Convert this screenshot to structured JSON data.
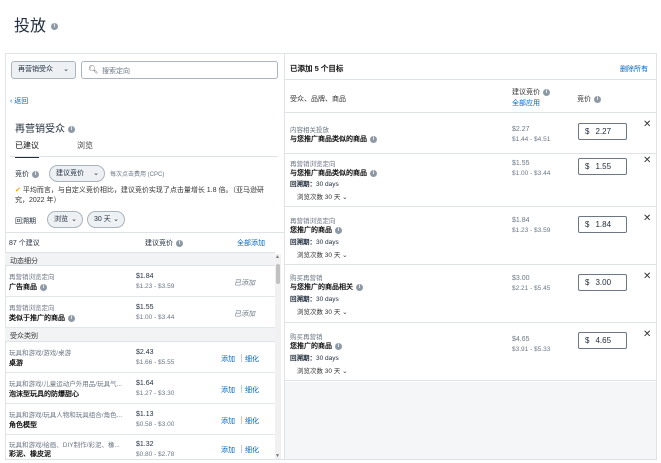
{
  "page": {
    "title": "投放"
  },
  "left": {
    "audience_dropdown": "再营销受众",
    "search_placeholder": "搜索定向",
    "back_label": "返回",
    "section_title": "再营销受众",
    "tabs": [
      "已建议",
      "浏览"
    ],
    "bid_label": "竞价",
    "bid_select": "建议竞价",
    "bid_note": "每次点击费用 (CPC)",
    "tip": "平均而言，与自定义竞价相比，建议竞价实现了点击量增长 1.8 倍。（亚马逊研究，2022 年）",
    "lookback_label": "回溯期",
    "lookback_select1": "浏览",
    "lookback_select2": "30 天",
    "count_label": "87 个建议",
    "suggested_bid_header": "建议竞价",
    "add_all": "全部添加",
    "groups": [
      {
        "name": "动态细分",
        "items": [
          {
            "category": "再营销浏览定向",
            "title": "广告商品",
            "bid": "$1.84",
            "range": "$1.23 - $3.59",
            "status": "已添加"
          },
          {
            "category": "再营销浏览定向",
            "title": "类似于推广的商品",
            "bid": "$1.55",
            "range": "$1.00 - $3.44",
            "status": "已添加"
          }
        ]
      },
      {
        "name": "受众类别",
        "items": [
          {
            "category": "玩具和游戏/游戏/桌游",
            "title": "桌游",
            "bid": "$2.43",
            "range": "$1.66 - $5.55",
            "add": "添加",
            "refine": "细化"
          },
          {
            "category": "玩具和游戏/儿童运动户外用品/玩具气...",
            "title": "泡沫型玩具的防爆甜心",
            "bid": "$1.64",
            "range": "$1.27 - $3.30",
            "add": "添加",
            "refine": "细化"
          },
          {
            "category": "玩具和游戏/玩具人物和玩具组合/角色...",
            "title": "角色模型",
            "bid": "$1.13",
            "range": "$0.58 - $3.00",
            "add": "添加",
            "refine": "细化"
          },
          {
            "category": "玩具和游戏/绘画、DIY制作/彩泥、橡...",
            "title": "彩泥、橡皮泥",
            "bid": "$1.32",
            "range": "$0.80 - $2.78",
            "add": "添加",
            "refine": "细化"
          }
        ]
      }
    ]
  },
  "right": {
    "header": "已添加 5 个目标",
    "remove_all": "删除所有",
    "col_audience": "受众、品牌、商品",
    "col_suggested": "建议竞价",
    "apply_all": "全部应用",
    "col_bid": "竞价",
    "lookback_prefix": "回溯期：",
    "items": [
      {
        "category": "内容相关投放",
        "title": "与您推广商品类似的商品",
        "lookback": "",
        "browse": "",
        "bid": "$2.27",
        "range": "$1.44 - $4.51",
        "value": "2.27"
      },
      {
        "category": "再营销浏览定向",
        "title": "与您推广商品类似的商品",
        "lookback": "30 days",
        "browse": "浏览次数 30 天",
        "bid": "$1.55",
        "range": "$1.00 - $3.44",
        "value": "1.55"
      },
      {
        "category": "再营销浏览定向",
        "title": "您推广的商品",
        "lookback": "30 days",
        "browse": "浏览次数 30 天",
        "bid": "$1.84",
        "range": "$1.23 - $3.59",
        "value": "1.84"
      },
      {
        "category": "购买再营销",
        "title": "与您推广的商品相关",
        "lookback": "30 days",
        "browse": "浏览次数 30 天",
        "bid": "$3.00",
        "range": "$2.21 - $5.45",
        "value": "3.00"
      },
      {
        "category": "购买再营销",
        "title": "您推广的商品",
        "lookback": "30 days",
        "browse": "浏览次数 30 天",
        "bid": "$4.65",
        "range": "$3.91 - $5.33",
        "value": "4.65"
      }
    ]
  },
  "currency": "$"
}
